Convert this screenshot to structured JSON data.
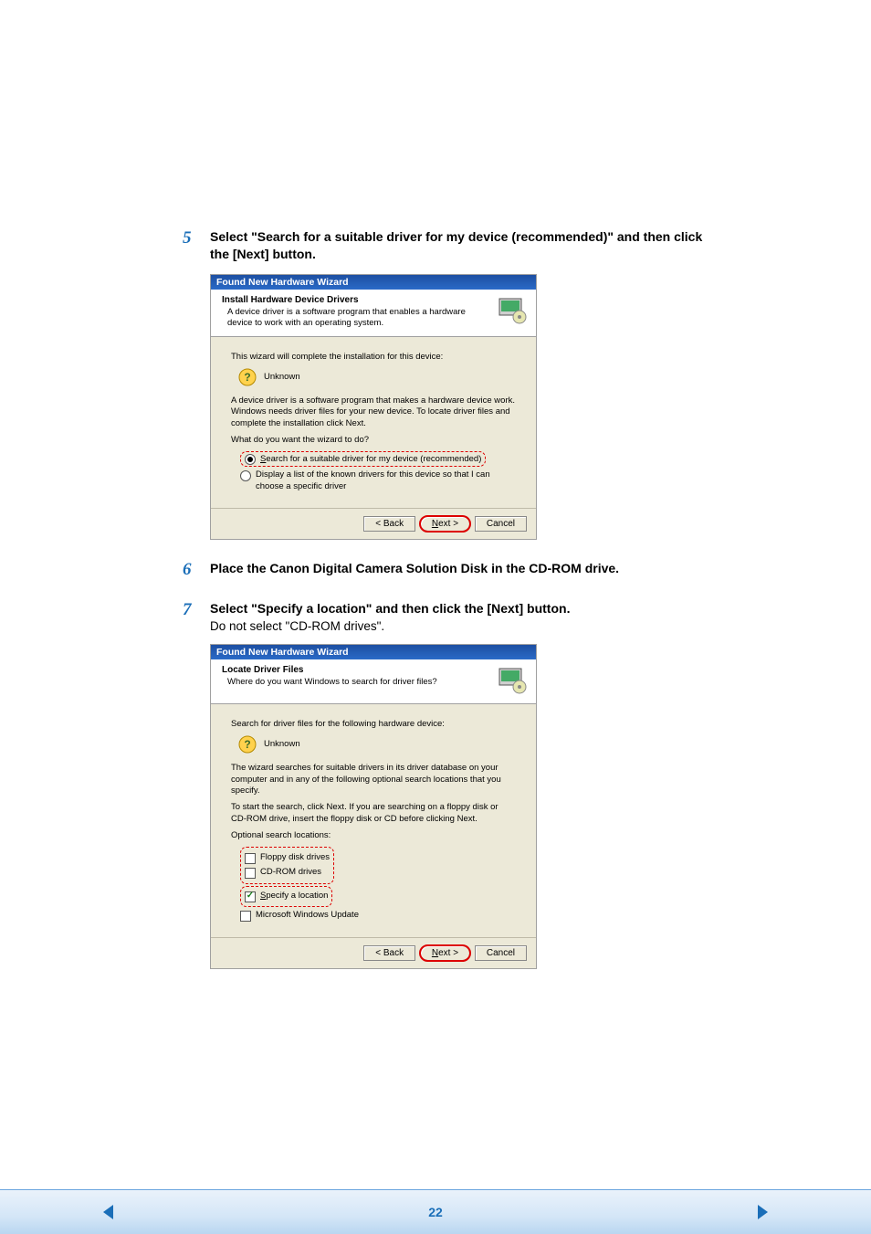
{
  "steps": {
    "s5": {
      "num": "5",
      "title": "Select \"Search for a suitable driver for my device (recommended)\" and then click the [Next] button."
    },
    "s6": {
      "num": "6",
      "title": "Place the Canon Digital Camera Solution Disk in the CD-ROM drive."
    },
    "s7": {
      "num": "7",
      "title": "Select \"Specify a location\" and then click the [Next] button.",
      "sub": "Do not select \"CD-ROM drives\"."
    }
  },
  "wizard1": {
    "window_title": "Found New Hardware Wizard",
    "header_title": "Install Hardware Device Drivers",
    "header_sub": "A device driver is a software program that enables a hardware device to work with an operating system.",
    "line1": "This wizard will complete the installation for this device:",
    "unknown": "Unknown",
    "line2": "A device driver is a software program that makes a hardware device work. Windows needs driver files for your new device. To locate driver files and complete the installation click Next.",
    "line3": "What do you want the wizard to do?",
    "opt1": "Search for a suitable driver for my device (recommended)",
    "opt2": "Display a list of the known drivers for this device so that I can choose a specific driver",
    "back": "< Back",
    "next": "Next >",
    "cancel": "Cancel"
  },
  "wizard2": {
    "window_title": "Found New Hardware Wizard",
    "header_title": "Locate Driver Files",
    "header_sub": "Where do you want Windows to search for driver files?",
    "line1": "Search for driver files for the following hardware device:",
    "unknown": "Unknown",
    "line2": "The wizard searches for suitable drivers in its driver database on your computer and in any of the following optional search locations that you specify.",
    "line3": "To start the search, click Next. If you are searching on a floppy disk or CD-ROM drive, insert the floppy disk or CD before clicking Next.",
    "line4": "Optional search locations:",
    "chk1": "Floppy disk drives",
    "chk2": "CD-ROM drives",
    "chk3": "Specify a location",
    "chk4": "Microsoft Windows Update",
    "back": "< Back",
    "next": "Next >",
    "cancel": "Cancel"
  },
  "footer": {
    "page": "22"
  }
}
